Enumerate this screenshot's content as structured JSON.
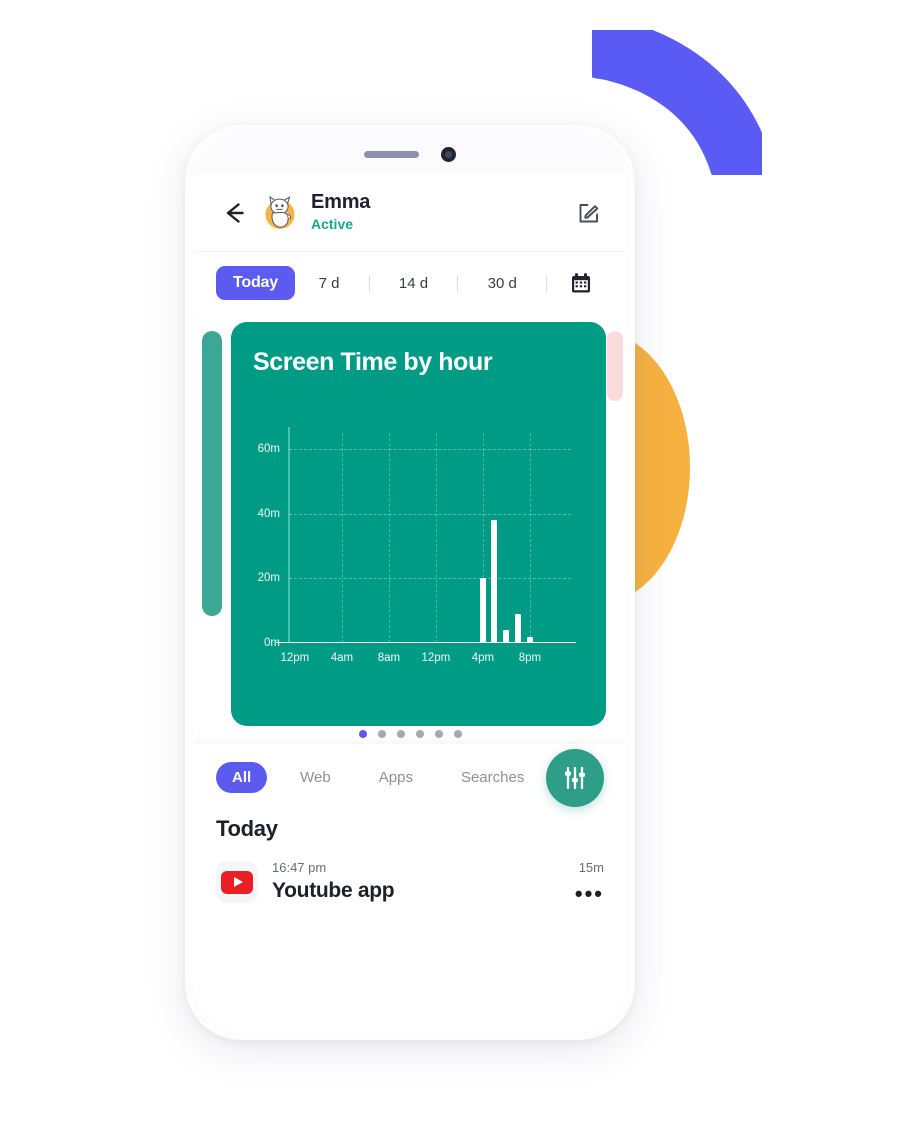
{
  "decor": {
    "arc_color": "#5A5AF5",
    "circle_color": "#F6B13F",
    "peek_left_color": "#3AA892",
    "peek_right_color": "#FADCDC"
  },
  "phone": {
    "notch": {
      "speaker": "speaker-grille",
      "camera": "front-camera"
    }
  },
  "header": {
    "back_icon": "back-arrow-icon",
    "avatar_icon": "cat-avatar",
    "name": "Emma",
    "status": "Active",
    "status_color": "#17A887",
    "edit_icon": "edit-pencil-icon"
  },
  "range_selector": {
    "active_label": "Today",
    "active_color": "#5B5BF0",
    "options": [
      "7 d",
      "14 d",
      "30 d"
    ],
    "calendar_icon": "calendar-icon"
  },
  "chart_data": {
    "type": "bar",
    "title": "Screen Time by hour",
    "xlabel": "",
    "ylabel": "",
    "ylim": [
      0,
      65
    ],
    "yticks": [
      0,
      20,
      40,
      60
    ],
    "ytick_labels": [
      "0m",
      "20m",
      "40m",
      "60m"
    ],
    "xtick_labels": [
      "12pm",
      "4am",
      "8am",
      "12pm",
      "4pm",
      "8pm"
    ],
    "xtick_positions": [
      0,
      4,
      8,
      12,
      16,
      20
    ],
    "grid": true,
    "legend": false,
    "bar_color": "#FFFFFF",
    "background_color": "#009B85",
    "x": [
      0,
      1,
      2,
      3,
      4,
      5,
      6,
      7,
      8,
      9,
      10,
      11,
      12,
      13,
      14,
      15,
      16,
      17,
      18,
      19,
      20,
      21,
      22,
      23
    ],
    "values": [
      0,
      0,
      0,
      0,
      0,
      0,
      0,
      0,
      0,
      0,
      0,
      0,
      0,
      0,
      0,
      0,
      20,
      38,
      4,
      9,
      2,
      0,
      0,
      0
    ],
    "units": "minutes"
  },
  "carousel": {
    "dot_count": 6,
    "active_dot": 0,
    "active_dot_color": "#5B5BF0",
    "dot_color": "#A8A9B4"
  },
  "activity": {
    "tabs": [
      {
        "label": "All",
        "active": true
      },
      {
        "label": "Web",
        "active": false
      },
      {
        "label": "Apps",
        "active": false
      },
      {
        "label": "Searches",
        "active": false
      }
    ],
    "filter_button_icon": "sliders-icon",
    "filter_button_color": "#2E9E89",
    "section_title": "Today",
    "rows": [
      {
        "icon": "youtube-icon",
        "time": "16:47 pm",
        "title": "Youtube app",
        "duration": "15m",
        "more": "•••"
      }
    ]
  }
}
